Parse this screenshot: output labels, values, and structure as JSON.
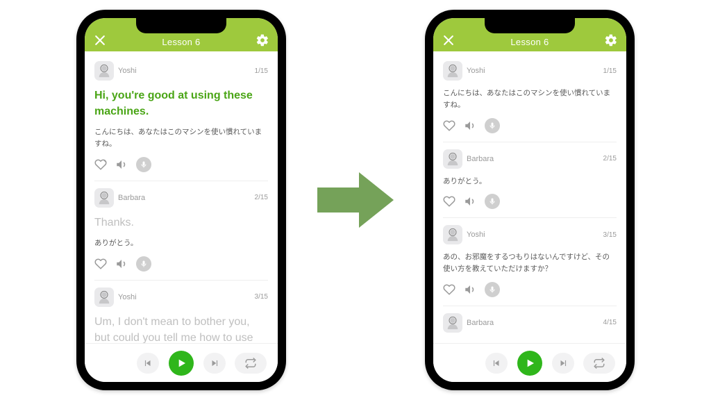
{
  "header": {
    "title": "Lesson 6"
  },
  "totalSteps": 15,
  "left": {
    "items": [
      {
        "speaker": "Yoshi",
        "idx": 1,
        "english": "Hi, you're good at using these machines.",
        "jp": "こんにちは、あなたはこのマシンを使い慣れていますね。",
        "active": true,
        "showEnglish": true,
        "showPlayer": true
      },
      {
        "speaker": "Barbara",
        "idx": 2,
        "english": "Thanks.",
        "jp": "ありがとう。",
        "active": false,
        "showEnglish": true,
        "englishMuted": true,
        "showPlayer": true
      },
      {
        "speaker": "Yoshi",
        "idx": 3,
        "english": "Um, I don't mean to bother you, but could you tell me how to use",
        "jp": "",
        "active": false,
        "showEnglish": true,
        "englishMuted": true,
        "showPlayer": false
      }
    ]
  },
  "right": {
    "items": [
      {
        "speaker": "Yoshi",
        "idx": 1,
        "jp": "こんにちは、あなたはこのマシンを使い慣れていますね。",
        "showEnglish": false,
        "showPlayer": true
      },
      {
        "speaker": "Barbara",
        "idx": 2,
        "jp": "ありがとう。",
        "showEnglish": false,
        "showPlayer": true
      },
      {
        "speaker": "Yoshi",
        "idx": 3,
        "jp": "あの、お邪魔をするつもりはないんですけど、その使い方を教えていただけますか？",
        "showEnglish": false,
        "showPlayer": true
      },
      {
        "speaker": "Barbara",
        "idx": 4,
        "jp": "",
        "showEnglish": false,
        "showPlayer": false
      }
    ]
  }
}
